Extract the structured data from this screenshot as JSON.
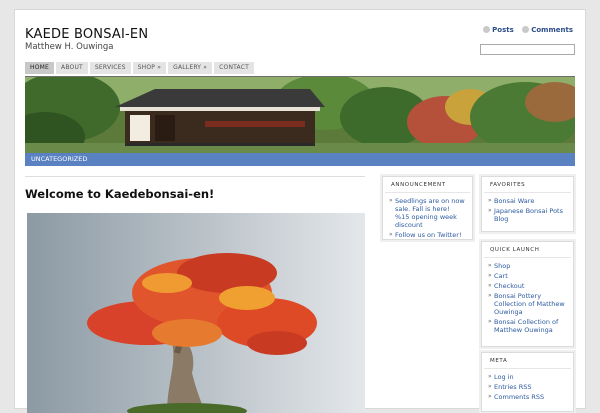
{
  "site": {
    "title": "KAEDE BONSAI-EN",
    "description": "Matthew H. Ouwinga"
  },
  "feeds": {
    "posts": "Posts",
    "comments": "Comments"
  },
  "nav": [
    {
      "label": "HOME",
      "active": true
    },
    {
      "label": "ABOUT",
      "active": false
    },
    {
      "label": "SERVICES",
      "active": false
    },
    {
      "label": "SHOP »",
      "active": false
    },
    {
      "label": "GALLERY »",
      "active": false
    },
    {
      "label": "CONTACT",
      "active": false
    }
  ],
  "category_bar": "UNCATEGORIZED",
  "post": {
    "title": "Welcome to Kaedebonsai-en!"
  },
  "widgets": {
    "announcement": {
      "title": "ANNOUNCEMENT",
      "items": [
        "Seedlings are on now sale. Fall is here! %15 opening week discount",
        "Follow us on Twitter!"
      ]
    },
    "favorites": {
      "title": "FAVORITES",
      "items": [
        "Bonsai Ware",
        "Japanese Bonsai Pots Blog"
      ]
    },
    "quick_launch": {
      "title": "QUICK LAUNCH",
      "items": [
        "Shop",
        "Cart",
        "Checkout",
        "Bonsai Pottery Collection of Matthew Ouwinga",
        "Bonsai Collection of Matthew Ouwinga"
      ]
    },
    "meta": {
      "title": "META",
      "items": [
        "Log in",
        "Entries RSS",
        "Comments RSS"
      ]
    }
  },
  "colors": {
    "link": "#2c5aa0",
    "category_bar": "#5a82c2",
    "nav_border": "#6d6d6d"
  }
}
